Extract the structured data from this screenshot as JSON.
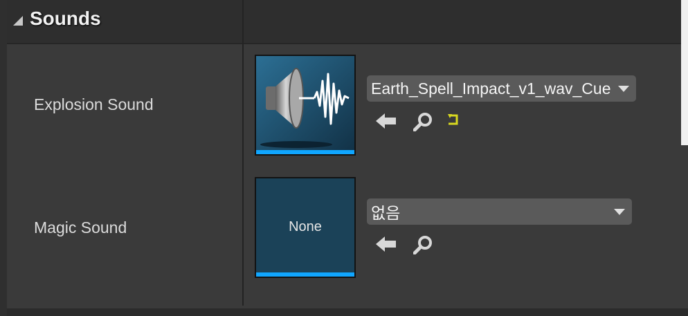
{
  "category": {
    "title": "Sounds"
  },
  "properties": [
    {
      "label": "Explosion Sound",
      "asset_value": "Earth_Spell_Impact_v1_wav_Cue",
      "thumbnail_icon": "sound-cue-speaker-icon",
      "buttons": [
        "use-selected-arrow-icon",
        "browse-magnifier-icon",
        "reset-to-default-icon"
      ]
    },
    {
      "label": "Magic Sound",
      "asset_value": "없음",
      "thumbnail_text": "None",
      "buttons": [
        "use-selected-arrow-icon",
        "browse-magnifier-icon"
      ]
    }
  ],
  "colors": {
    "panel_bg": "#3a3a3a",
    "header_bg": "#2e2e2e",
    "thumbnail_bg": "#173a4e",
    "asset_bar": "#10a6ff",
    "combo_bg": "#5a5a5a",
    "reset_icon": "#d8d820"
  }
}
